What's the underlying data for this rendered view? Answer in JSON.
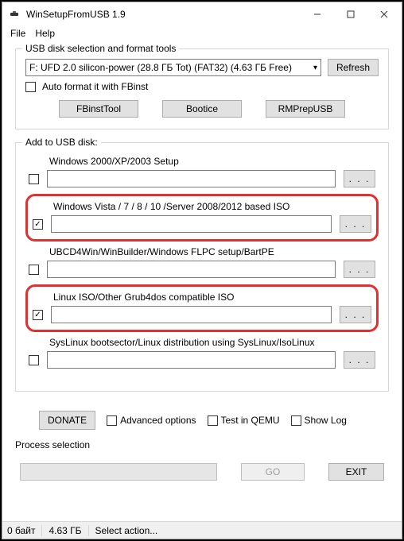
{
  "window": {
    "title": "WinSetupFromUSB 1.9"
  },
  "menu": {
    "file": "File",
    "help": "Help"
  },
  "usb_group": {
    "title": "USB disk selection and format tools",
    "selected_disk": "F: UFD 2.0 silicon-power (28.8 ГБ Tot) (FAT32) (4.63 ГБ Free)",
    "refresh": "Refresh",
    "autoformat": "Auto format it with FBinst",
    "fbinst": "FBinstTool",
    "bootice": "Bootice",
    "rmprep": "RMPrepUSB"
  },
  "add_group": {
    "title": "Add to USB disk:",
    "entries": [
      {
        "label": "Windows 2000/XP/2003 Setup",
        "checked": false,
        "highlight": false
      },
      {
        "label": "Windows Vista / 7 / 8 / 10 /Server 2008/2012 based ISO",
        "checked": true,
        "highlight": true
      },
      {
        "label": "UBCD4Win/WinBuilder/Windows FLPC setup/BartPE",
        "checked": false,
        "highlight": false
      },
      {
        "label": "Linux ISO/Other Grub4dos compatible ISO",
        "checked": true,
        "highlight": true
      },
      {
        "label": "SysLinux bootsector/Linux distribution using SysLinux/IsoLinux",
        "checked": false,
        "highlight": false
      }
    ],
    "browse": ". . ."
  },
  "options": {
    "donate": "DONATE",
    "advanced": "Advanced options",
    "test_qemu": "Test in QEMU",
    "show_log": "Show Log"
  },
  "process": {
    "label": "Process selection",
    "go": "GO",
    "exit": "EXIT"
  },
  "status": {
    "bytes": "0 байт",
    "size": "4.63 ГБ",
    "action": "Select action..."
  }
}
